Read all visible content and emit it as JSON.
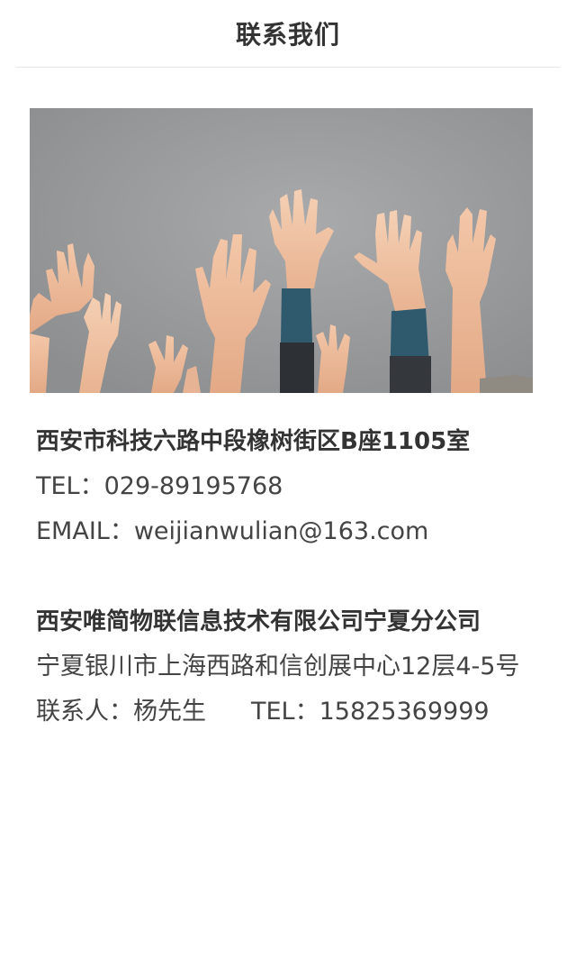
{
  "header": {
    "title": "联系我们"
  },
  "banner": {
    "image_alt": "raised hands"
  },
  "office1": {
    "address": "西安市科技六路中段橡树街区B座1105室",
    "tel": "TEL：029-89195768",
    "email": "EMAIL：weijianwulian@163.com"
  },
  "office2": {
    "company": "西安唯简物联信息技术有限公司宁夏分公司",
    "address": "宁夏银川市上海西路和信创展中心12层4-5号",
    "contact": "联系人：杨先生",
    "tel": "TEL：15825369999"
  }
}
